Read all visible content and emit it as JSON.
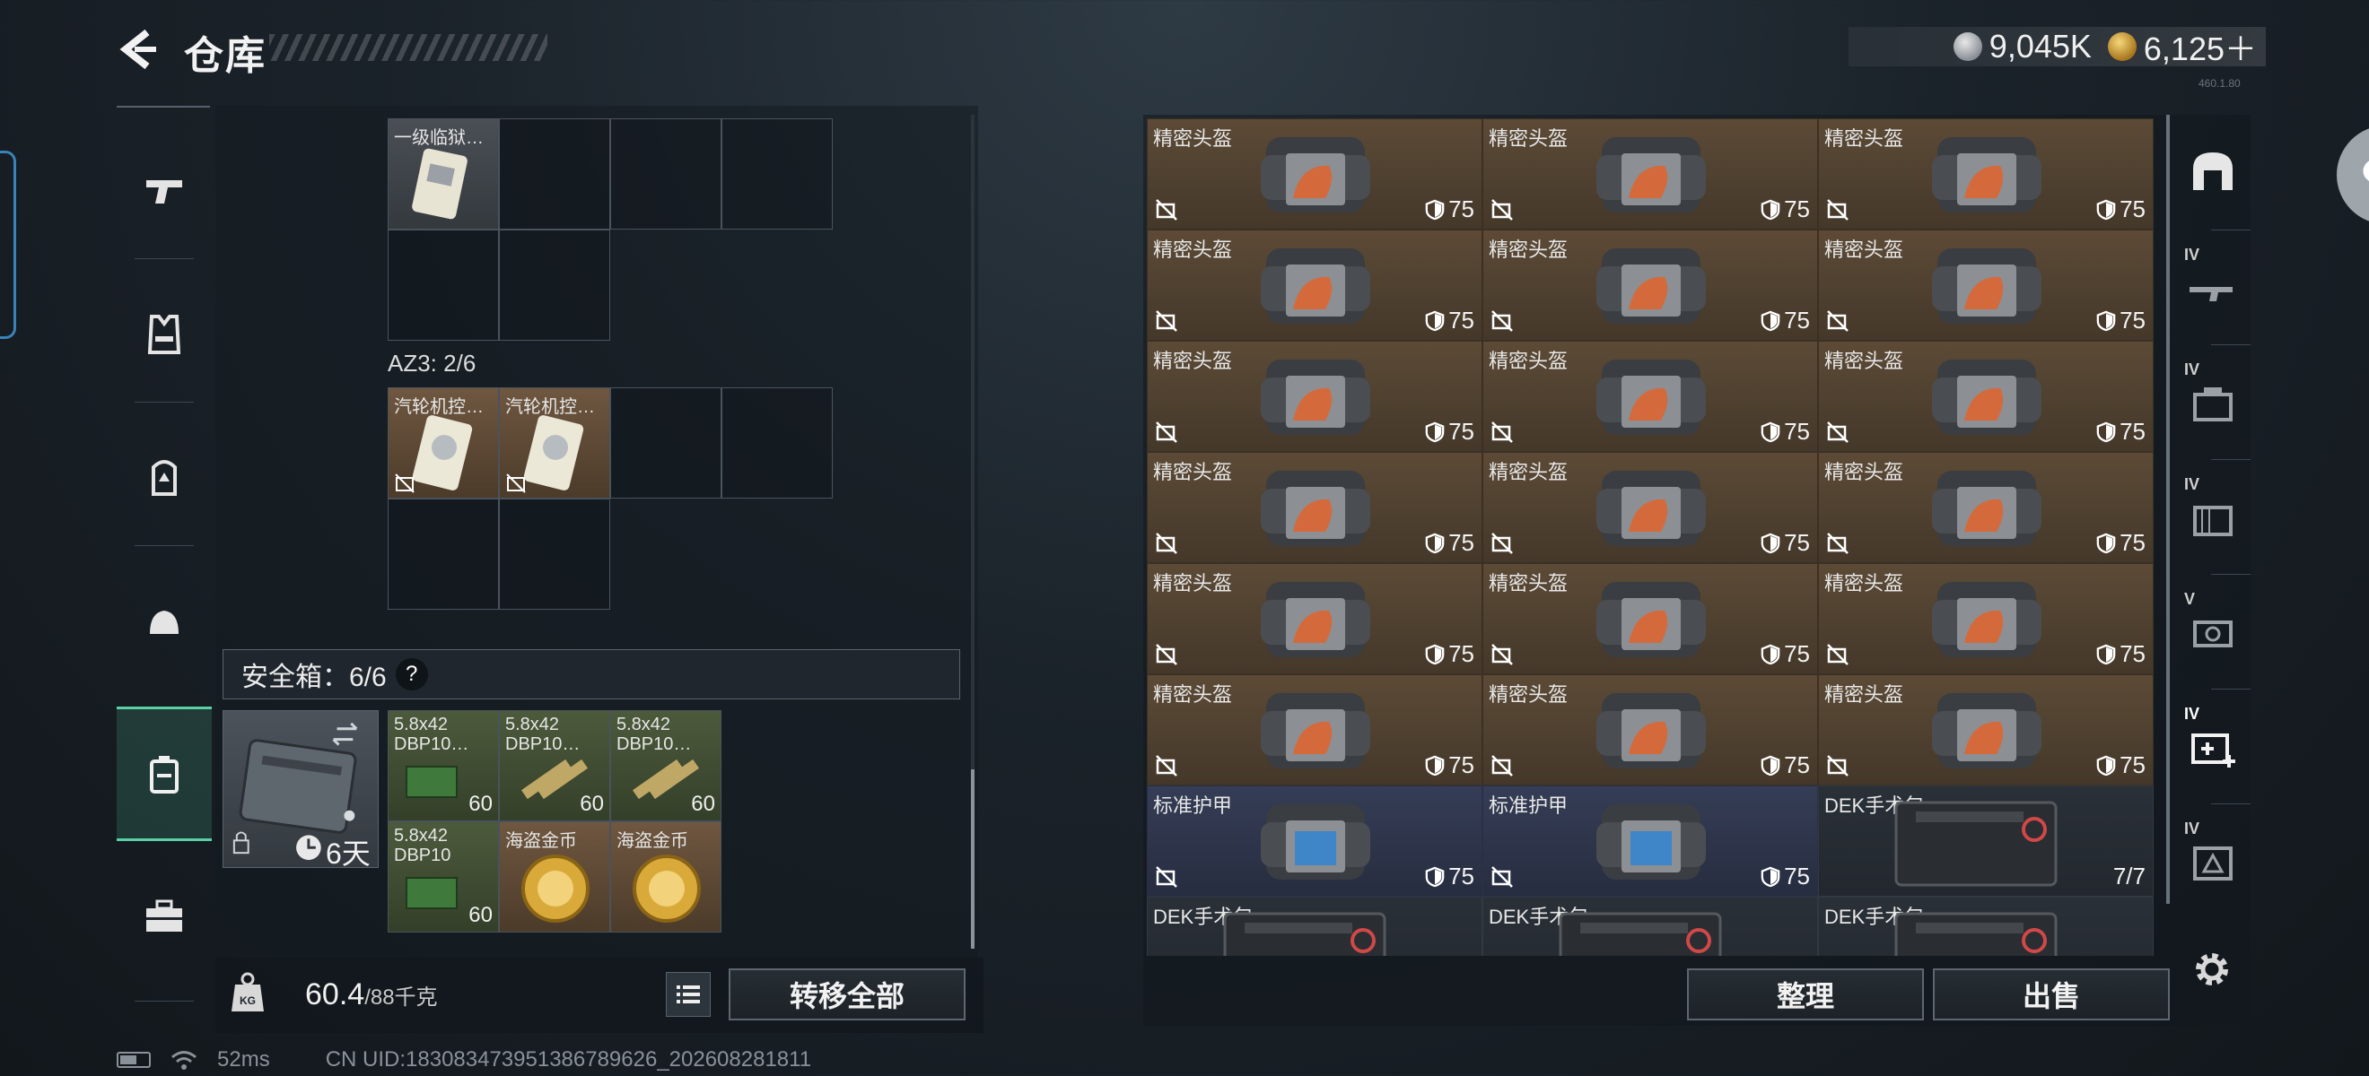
{
  "header": {
    "title": "仓库",
    "currencies": [
      {
        "icon": "silver-coin-icon",
        "value": "9,045K"
      },
      {
        "icon": "gold-coin-icon",
        "value": "6,125＋"
      }
    ],
    "version": "460.1.80"
  },
  "left_rail": {
    "items": [
      {
        "name": "weapon",
        "icon": "pistol-icon"
      },
      {
        "name": "armor",
        "icon": "vest-icon"
      },
      {
        "name": "backpack",
        "icon": "backpack-icon"
      },
      {
        "name": "helmet",
        "icon": "helmet-bag-icon"
      },
      {
        "name": "safe-box",
        "icon": "safe-box-icon",
        "active": true
      },
      {
        "name": "toolbox",
        "icon": "toolbox-icon"
      }
    ]
  },
  "loadout": {
    "rig_items": [
      {
        "name": "一级临狱…"
      }
    ],
    "az3_label": "AZ3: 2/6",
    "az3_items": [
      {
        "name": "汽轮机控…"
      },
      {
        "name": "汽轮机控…"
      }
    ],
    "safe_box": {
      "label": "安全箱：6/6",
      "help": "?",
      "timer": "6天",
      "items": [
        {
          "name": "5.8x42 DBP10…",
          "count": "60"
        },
        {
          "name": "5.8x42 DBP10…",
          "count": "60"
        },
        {
          "name": "5.8x42 DBP10…",
          "count": "60"
        },
        {
          "name": "5.8x42 DBP10",
          "count": "60"
        },
        {
          "name": "海盗金币",
          "count": ""
        },
        {
          "name": "海盗金币",
          "count": ""
        }
      ]
    }
  },
  "footer_left": {
    "weight_value": "60.4",
    "weight_max": "/88千克",
    "transfer_label": "转移全部"
  },
  "stash": {
    "items": [
      {
        "name": "精密头盔",
        "dur": "75",
        "type": "helmet"
      },
      {
        "name": "精密头盔",
        "dur": "75",
        "type": "helmet"
      },
      {
        "name": "精密头盔",
        "dur": "75",
        "type": "helmet"
      },
      {
        "name": "精密头盔",
        "dur": "75",
        "type": "helmet"
      },
      {
        "name": "精密头盔",
        "dur": "75",
        "type": "helmet"
      },
      {
        "name": "精密头盔",
        "dur": "75",
        "type": "helmet"
      },
      {
        "name": "精密头盔",
        "dur": "75",
        "type": "helmet"
      },
      {
        "name": "精密头盔",
        "dur": "75",
        "type": "helmet"
      },
      {
        "name": "精密头盔",
        "dur": "75",
        "type": "helmet"
      },
      {
        "name": "精密头盔",
        "dur": "75",
        "type": "helmet"
      },
      {
        "name": "精密头盔",
        "dur": "75",
        "type": "helmet"
      },
      {
        "name": "精密头盔",
        "dur": "75",
        "type": "helmet"
      },
      {
        "name": "精密头盔",
        "dur": "75",
        "type": "helmet"
      },
      {
        "name": "精密头盔",
        "dur": "75",
        "type": "helmet"
      },
      {
        "name": "精密头盔",
        "dur": "75",
        "type": "helmet"
      },
      {
        "name": "精密头盔",
        "dur": "75",
        "type": "helmet"
      },
      {
        "name": "精密头盔",
        "dur": "75",
        "type": "helmet"
      },
      {
        "name": "精密头盔",
        "dur": "75",
        "type": "helmet"
      },
      {
        "name": "标准护甲",
        "dur": "75",
        "type": "armor"
      },
      {
        "name": "标准护甲",
        "dur": "75",
        "type": "armor"
      },
      {
        "name": "DEK手术包",
        "dur": "7/7",
        "type": "medkit"
      },
      {
        "name": "DEK手术包",
        "dur": "",
        "type": "medkit"
      },
      {
        "name": "DEK手术包",
        "dur": "",
        "type": "medkit"
      },
      {
        "name": "DEK手术包",
        "dur": "",
        "type": "medkit"
      }
    ],
    "sort_label": "整理",
    "sell_label": "出售"
  },
  "right_rail": {
    "items": [
      {
        "tier": "",
        "icon": "helmet-arch-icon"
      },
      {
        "tier": "IV",
        "icon": "rifle-icon"
      },
      {
        "tier": "IV",
        "icon": "mag-icon"
      },
      {
        "tier": "IV",
        "icon": "ammo-box-icon"
      },
      {
        "tier": "V",
        "icon": "gadget-icon"
      },
      {
        "tier": "IV",
        "icon": "medkit-icon"
      },
      {
        "tier": "IV",
        "icon": "warning-box-icon"
      }
    ]
  },
  "status_bar": {
    "ping": "52ms",
    "uid": "CN UID:18308347395138678962​6_202608281811"
  }
}
